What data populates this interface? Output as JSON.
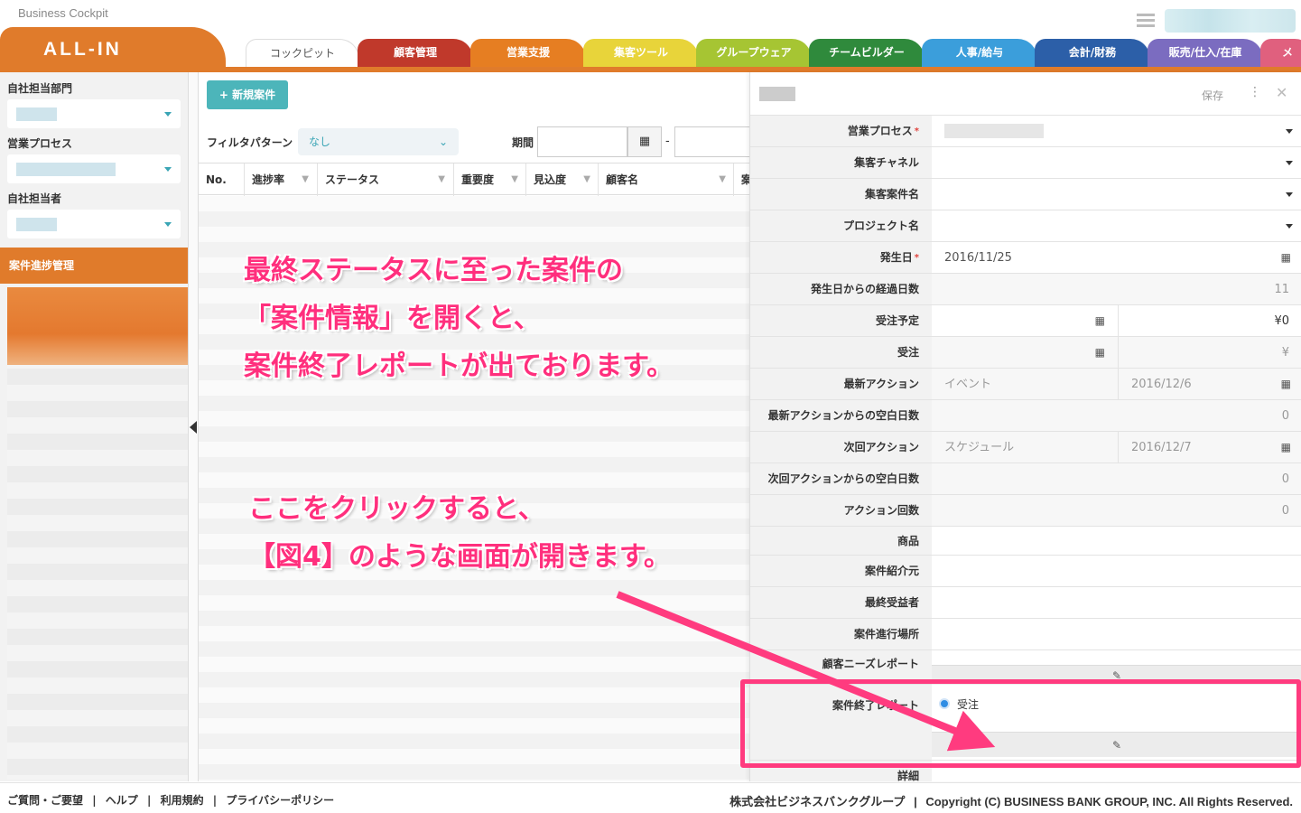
{
  "app": {
    "title": "Business Cockpit",
    "logo": "ALL-IN"
  },
  "tabs": [
    {
      "label": "コックピット",
      "color": "#ffffff"
    },
    {
      "label": "顧客管理",
      "color": "#c0392b"
    },
    {
      "label": "営業支援",
      "color": "#e67e22"
    },
    {
      "label": "集客ツール",
      "color": "#e8d43a"
    },
    {
      "label": "グループウェア",
      "color": "#a6c533"
    },
    {
      "label": "チームビルダー",
      "color": "#2f8a3c"
    },
    {
      "label": "人事/給与",
      "color": "#3b9edb"
    },
    {
      "label": "会計/財務",
      "color": "#2c5fa8"
    },
    {
      "label": "販売/仕入/在庫",
      "color": "#7b6cc0"
    },
    {
      "label": "メ",
      "color": "#e0607e"
    }
  ],
  "sidebar": {
    "dept_label": "自社担当部門",
    "process_label": "営業プロセス",
    "owner_label": "自社担当者",
    "menu_label": "案件進捗管理"
  },
  "list": {
    "new_button": "新規案件",
    "filter_label": "フィルタパターン",
    "filter_value": "なし",
    "period_label": "期間",
    "columns": [
      "No.",
      "進捗率",
      "ステータス",
      "重要度",
      "見込度",
      "顧客名",
      "案"
    ]
  },
  "annotations": {
    "line1": "最終ステータスに至った案件の",
    "line2": "「案件情報」を開くと、",
    "line3": "案件終了レポートが出ております。",
    "line4": "ここをクリックすると、",
    "line5": "【図4】のような画面が開きます。"
  },
  "panel": {
    "save": "保存",
    "fields": {
      "sales_process": "営業プロセス",
      "channel": "集客チャネル",
      "campaign": "集客案件名",
      "project": "プロジェクト名",
      "occur_date": "発生日",
      "occur_date_value": "2016/11/25",
      "elapsed": "発生日からの経過日数",
      "elapsed_value": "11",
      "order_plan": "受注予定",
      "order_plan_amount": "¥0",
      "order": "受注",
      "order_amount": "¥",
      "latest_action": "最新アクション",
      "latest_action_type": "イベント",
      "latest_action_date": "2016/12/6",
      "latest_blank": "最新アクションからの空白日数",
      "latest_blank_value": "0",
      "next_action": "次回アクション",
      "next_action_type": "スケジュール",
      "next_action_date": "2016/12/7",
      "next_blank": "次回アクションからの空白日数",
      "next_blank_value": "0",
      "action_count": "アクション回数",
      "action_count_value": "0",
      "product": "商品",
      "referrer": "案件紹介元",
      "beneficiary": "最終受益者",
      "place": "案件進行場所",
      "needs_report": "顧客ニーズレポート",
      "end_report": "案件終了レポート",
      "end_report_value": "受注",
      "detail": "詳細"
    }
  },
  "footer": {
    "links": [
      "ご質問・ご要望",
      "|",
      "ヘルプ",
      "|",
      "利用規約",
      "|",
      "プライバシーポリシー"
    ],
    "company": "株式会社ビジネスバンクグループ",
    "sep": "|",
    "copyright": "Copyright (C) BUSINESS BANK GROUP, INC. All Rights Reserved."
  },
  "colors": {
    "accent": "#e07b2b",
    "annotation": "#ff2f7d",
    "teal": "#4cb5ba"
  }
}
